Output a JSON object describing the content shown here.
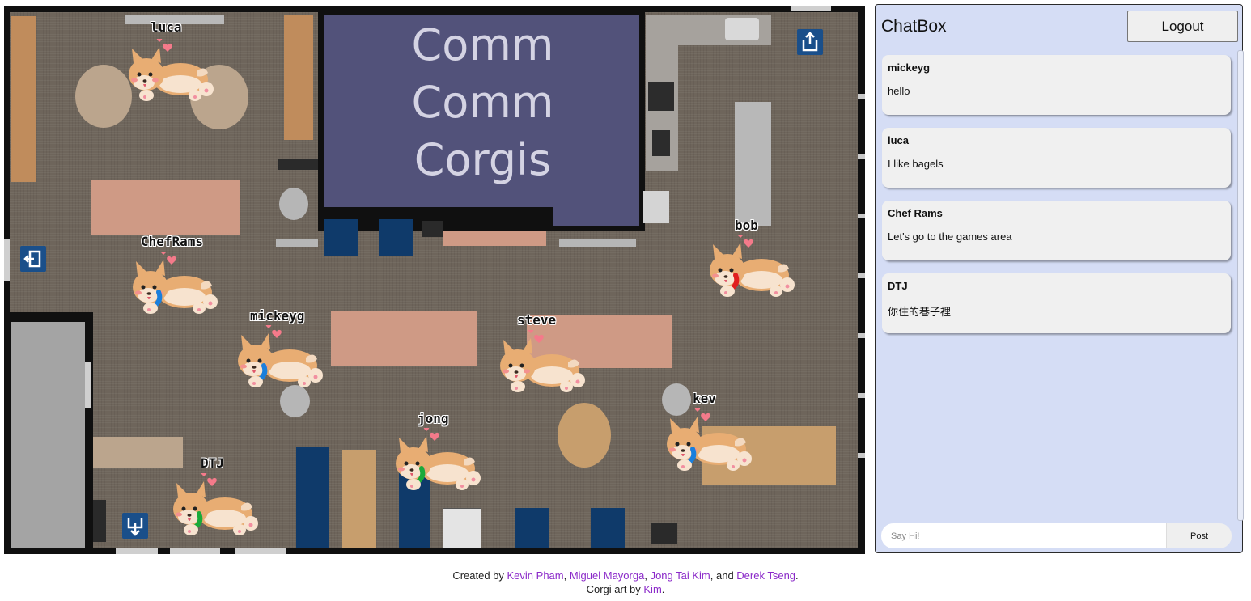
{
  "map": {
    "room_title_lines": [
      "Comm",
      "Comm",
      "Corgis"
    ],
    "colors": {
      "floor": "#6e655b",
      "wall": "#101010",
      "room": "#52527a",
      "table": "#cf9a85",
      "wood": "#c08c5c",
      "chair": "#0f3a6a",
      "sign": "#1a4f8a"
    },
    "players": [
      {
        "name": "luca",
        "collar": "none"
      },
      {
        "name": "ChefRams",
        "collar": "#1a7fdc"
      },
      {
        "name": "mickeyg",
        "collar": "#1a7fdc"
      },
      {
        "name": "steve",
        "collar": "none"
      },
      {
        "name": "bob",
        "collar": "#e01e1e"
      },
      {
        "name": "jong",
        "collar": "#1aaa3a"
      },
      {
        "name": "kev",
        "collar": "#1a7fdc"
      },
      {
        "name": "DTJ",
        "collar": "#1aaa3a"
      }
    ]
  },
  "chat": {
    "title": "ChatBox",
    "logout_label": "Logout",
    "messages": [
      {
        "user": "mickeyg",
        "text": "hello"
      },
      {
        "user": "luca",
        "text": "I like bagels"
      },
      {
        "user": "Chef Rams",
        "text": "Let's go to the games area"
      },
      {
        "user": "DTJ",
        "text": "你住的巷子裡"
      }
    ],
    "input_placeholder": "Say Hi!",
    "post_label": "Post"
  },
  "footer": {
    "created_prefix": "Created by ",
    "authors": [
      "Kevin Pham",
      "Miguel Mayorga",
      "Jong Tai Kim",
      "Derek Tseng"
    ],
    "sep1": ", ",
    "sep2": ", ",
    "sep3": ", and ",
    "end": ".",
    "art_prefix": "Corgi art by ",
    "artist": "Kim",
    "art_end": "."
  }
}
